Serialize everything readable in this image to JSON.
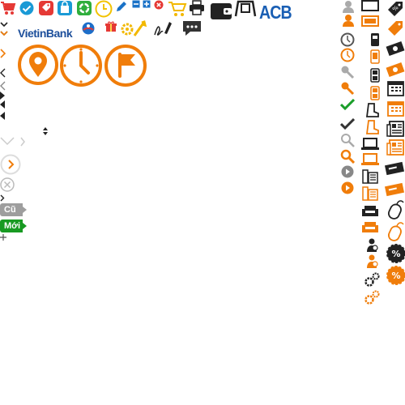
{
  "brands": {
    "vietinbank": "VietinBank",
    "acb": "ACB"
  },
  "tags": {
    "old": "Cũ",
    "new": "Mới"
  },
  "colors": {
    "orange": "#f07d0a",
    "blue": "#1a72c7",
    "dark": "#222222",
    "gray": "#8a8a8a",
    "green": "#1a9e2a",
    "red": "#e53935",
    "tag_old": "#9e9e9e",
    "tag_new": "#189a22"
  },
  "icons": [
    "cart-icon",
    "check-circle-icon",
    "price-tag-icon",
    "shopping-bag-icon",
    "recycle-icon",
    "clock-icon",
    "pencil-icon",
    "minus-icon",
    "plus-icon",
    "close-circle-icon",
    "cart-outline-icon",
    "printer-icon",
    "wallet-icon",
    "card-reader-icon",
    "gift-icon",
    "settings-wrench-icon",
    "sign-icon",
    "chat-icon",
    "location-pin-icon",
    "clock-large-icon",
    "flag-icon",
    "user-icon",
    "monitor-icon",
    "mobile-icon",
    "money-icon",
    "calendar-icon",
    "newspaper-icon",
    "laptop-icon",
    "fax-icon",
    "sofa-icon",
    "ticket-icon",
    "mouse-icon",
    "percent-badge-icon",
    "gears-icon",
    "search-icon",
    "play-icon"
  ]
}
